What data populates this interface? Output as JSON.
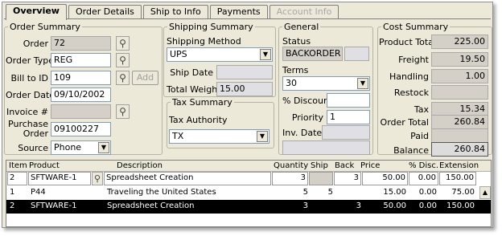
{
  "tabs": [
    {
      "label": "Overview"
    },
    {
      "label": "Order Details"
    },
    {
      "label": "Ship to Info"
    },
    {
      "label": "Payments"
    },
    {
      "label": "Account Info"
    }
  ],
  "order_summary": {
    "legend": "Order Summary",
    "order_label": "Order",
    "order_value": "72",
    "order_type_label": "Order Type",
    "order_type_value": "REG",
    "bill_to_label": "Bill to ID",
    "bill_to_value": "109",
    "add_label": "Add",
    "order_date_label": "Order Date",
    "order_date_value": "09/10/2002",
    "invoice_label": "Invoice #",
    "invoice_value": "",
    "po_label_1": "Purchase",
    "po_label_2": "Order",
    "po_value": "09100227",
    "source_label": "Source",
    "source_value": "Phone"
  },
  "shipping_summary": {
    "legend": "Shipping Summary",
    "method_label": "Shipping Method",
    "method_value": "UPS",
    "ship_date_label": "Ship Date",
    "ship_date_value": "",
    "weight_label": "Total Weight",
    "weight_value": "15.00"
  },
  "tax_summary": {
    "legend": "Tax Summary",
    "authority_label": "Tax Authority",
    "authority_value": "TX"
  },
  "general": {
    "legend": "General",
    "status_label": "Status",
    "status_value": "BACKORDER",
    "terms_label": "Terms",
    "terms_value": "30",
    "discount_label": "% Discount",
    "discount_value": "",
    "priority_label": "Priority",
    "priority_value": "1",
    "inv_date_label": "Inv. Date",
    "inv_date_value": ""
  },
  "cost_summary": {
    "legend": "Cost Summary",
    "product_total_label": "Product Total",
    "product_total_value": "225.00",
    "freight_label": "Freight",
    "freight_value": "19.50",
    "handling_label": "Handling",
    "handling_value": "1.00",
    "restock_label": "Restock",
    "restock_value": "",
    "tax_label": "Tax",
    "tax_value": "15.34",
    "order_total_label": "Order Total",
    "order_total_value": "260.84",
    "paid_label": "Paid",
    "paid_value": "",
    "balance_label": "Balance",
    "balance_value": "260.84"
  },
  "grid": {
    "headers": {
      "item": "Item",
      "product": "Product",
      "description": "Description",
      "quantity": "Quantity",
      "ship": "Ship",
      "back": "Back",
      "price": "Price",
      "disc": "% Disc.",
      "extension": "Extension"
    },
    "rows": [
      {
        "item": "2",
        "product": "SFTWARE-1",
        "description": "Spreadsheet Creation",
        "quantity": "3",
        "ship": "",
        "back": "3",
        "price": "50.00",
        "disc": "0.00",
        "extension": "150.00"
      },
      {
        "item": "1",
        "product": "P44",
        "description": "Traveling the United States",
        "quantity": "5",
        "ship": "5",
        "back": "",
        "price": "15.00",
        "disc": "0.00",
        "extension": "75.00"
      },
      {
        "item": "2",
        "product": "SFTWARE-1",
        "description": "Spreadsheet Creation",
        "quantity": "3",
        "ship": "",
        "back": "3",
        "price": "50.00",
        "disc": "0.00",
        "extension": "150.00"
      }
    ]
  }
}
